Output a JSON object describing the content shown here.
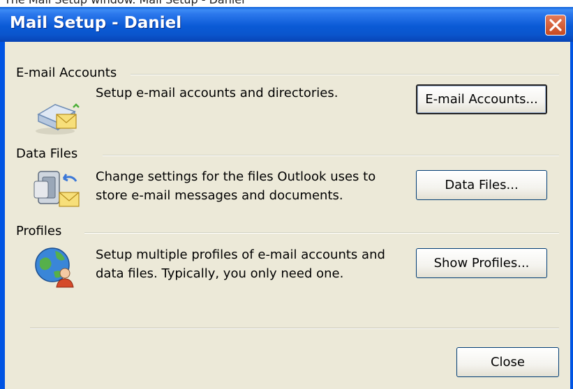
{
  "top_caption": "The Mail Setup window. Mail Setup - Daniel",
  "window": {
    "title": "Mail Setup - Daniel",
    "close_icon": "close-icon"
  },
  "groups": {
    "email_accounts": {
      "label": "E-mail Accounts",
      "description": "Setup e-mail accounts and directories.",
      "button": "E-mail Accounts...",
      "icon": "email-accounts-icon"
    },
    "data_files": {
      "label": "Data Files",
      "description_line1": "Change settings for the files Outlook uses to",
      "description_line2": "store e-mail messages and documents.",
      "button": "Data Files...",
      "icon": "data-files-icon"
    },
    "profiles": {
      "label": "Profiles",
      "description_line1": "Setup multiple profiles of e-mail accounts and",
      "description_line2": "data files. Typically, you only need one.",
      "button": "Show Profiles...",
      "icon": "profiles-icon"
    }
  },
  "footer": {
    "close_button": "Close"
  },
  "colors": {
    "titlebar_blue": "#0a5ad6",
    "close_red": "#c84a21",
    "dialog_bg": "#ece9d8"
  }
}
